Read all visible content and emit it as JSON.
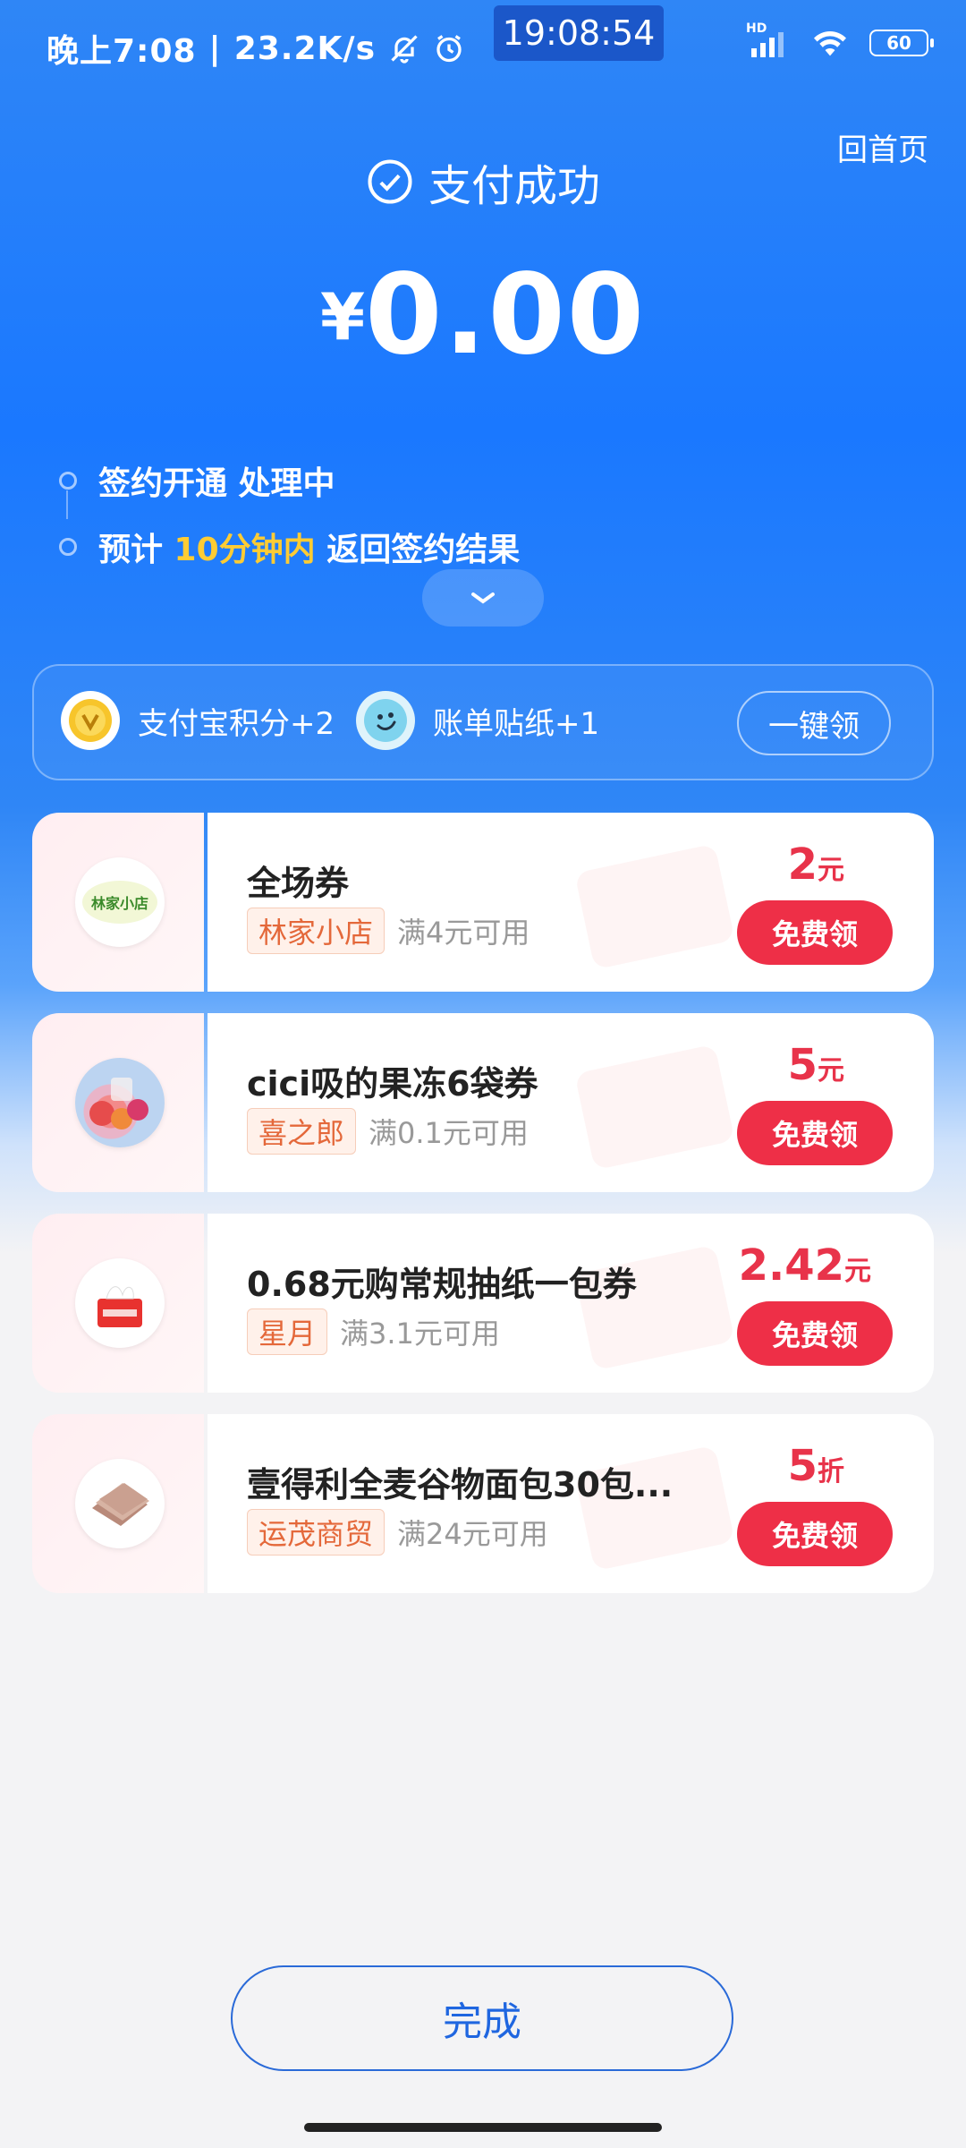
{
  "status_bar": {
    "time_text": "晚上7:08",
    "speed": "23.2K/s",
    "clock_pill": "19:08:54",
    "battery": "60",
    "hd_label": "HD"
  },
  "header": {
    "home_link": "回首页",
    "success_text": "支付成功",
    "currency": "¥",
    "amount": "0.00"
  },
  "steps": [
    {
      "text": "签约开通 处理中"
    },
    {
      "prefix": "预计 ",
      "highlight": "10分钟内",
      "suffix": " 返回签约结果"
    }
  ],
  "rewards": {
    "items": [
      {
        "label": "支付宝积分+2",
        "icon": "alipay-points-icon"
      },
      {
        "label": "账单贴纸+1",
        "icon": "sticker-icon"
      }
    ],
    "claim_all": "一键领"
  },
  "coupons": [
    {
      "title": "全场券",
      "shop": "林家小店",
      "condition": "满4元可用",
      "value": "2",
      "unit": "元",
      "button": "免费领",
      "logo_text": "林家小店"
    },
    {
      "title": "cici吸的果冻6袋券",
      "shop": "喜之郎",
      "condition": "满0.1元可用",
      "value": "5",
      "unit": "元",
      "button": "免费领"
    },
    {
      "title": "0.68元购常规抽纸一包券",
      "shop": "星月",
      "condition": "满3.1元可用",
      "value": "2.42",
      "unit": "元",
      "button": "免费领"
    },
    {
      "title": "壹得利全麦谷物面包30包...",
      "shop": "运茂商贸",
      "condition": "满24元可用",
      "value": "5",
      "unit": "折",
      "button": "免费领"
    }
  ],
  "footer": {
    "done_label": "完成"
  },
  "colors": {
    "primary_blue": "#1a78ff",
    "accent_red": "#ee2f47",
    "highlight_yellow": "#ffcc33"
  }
}
